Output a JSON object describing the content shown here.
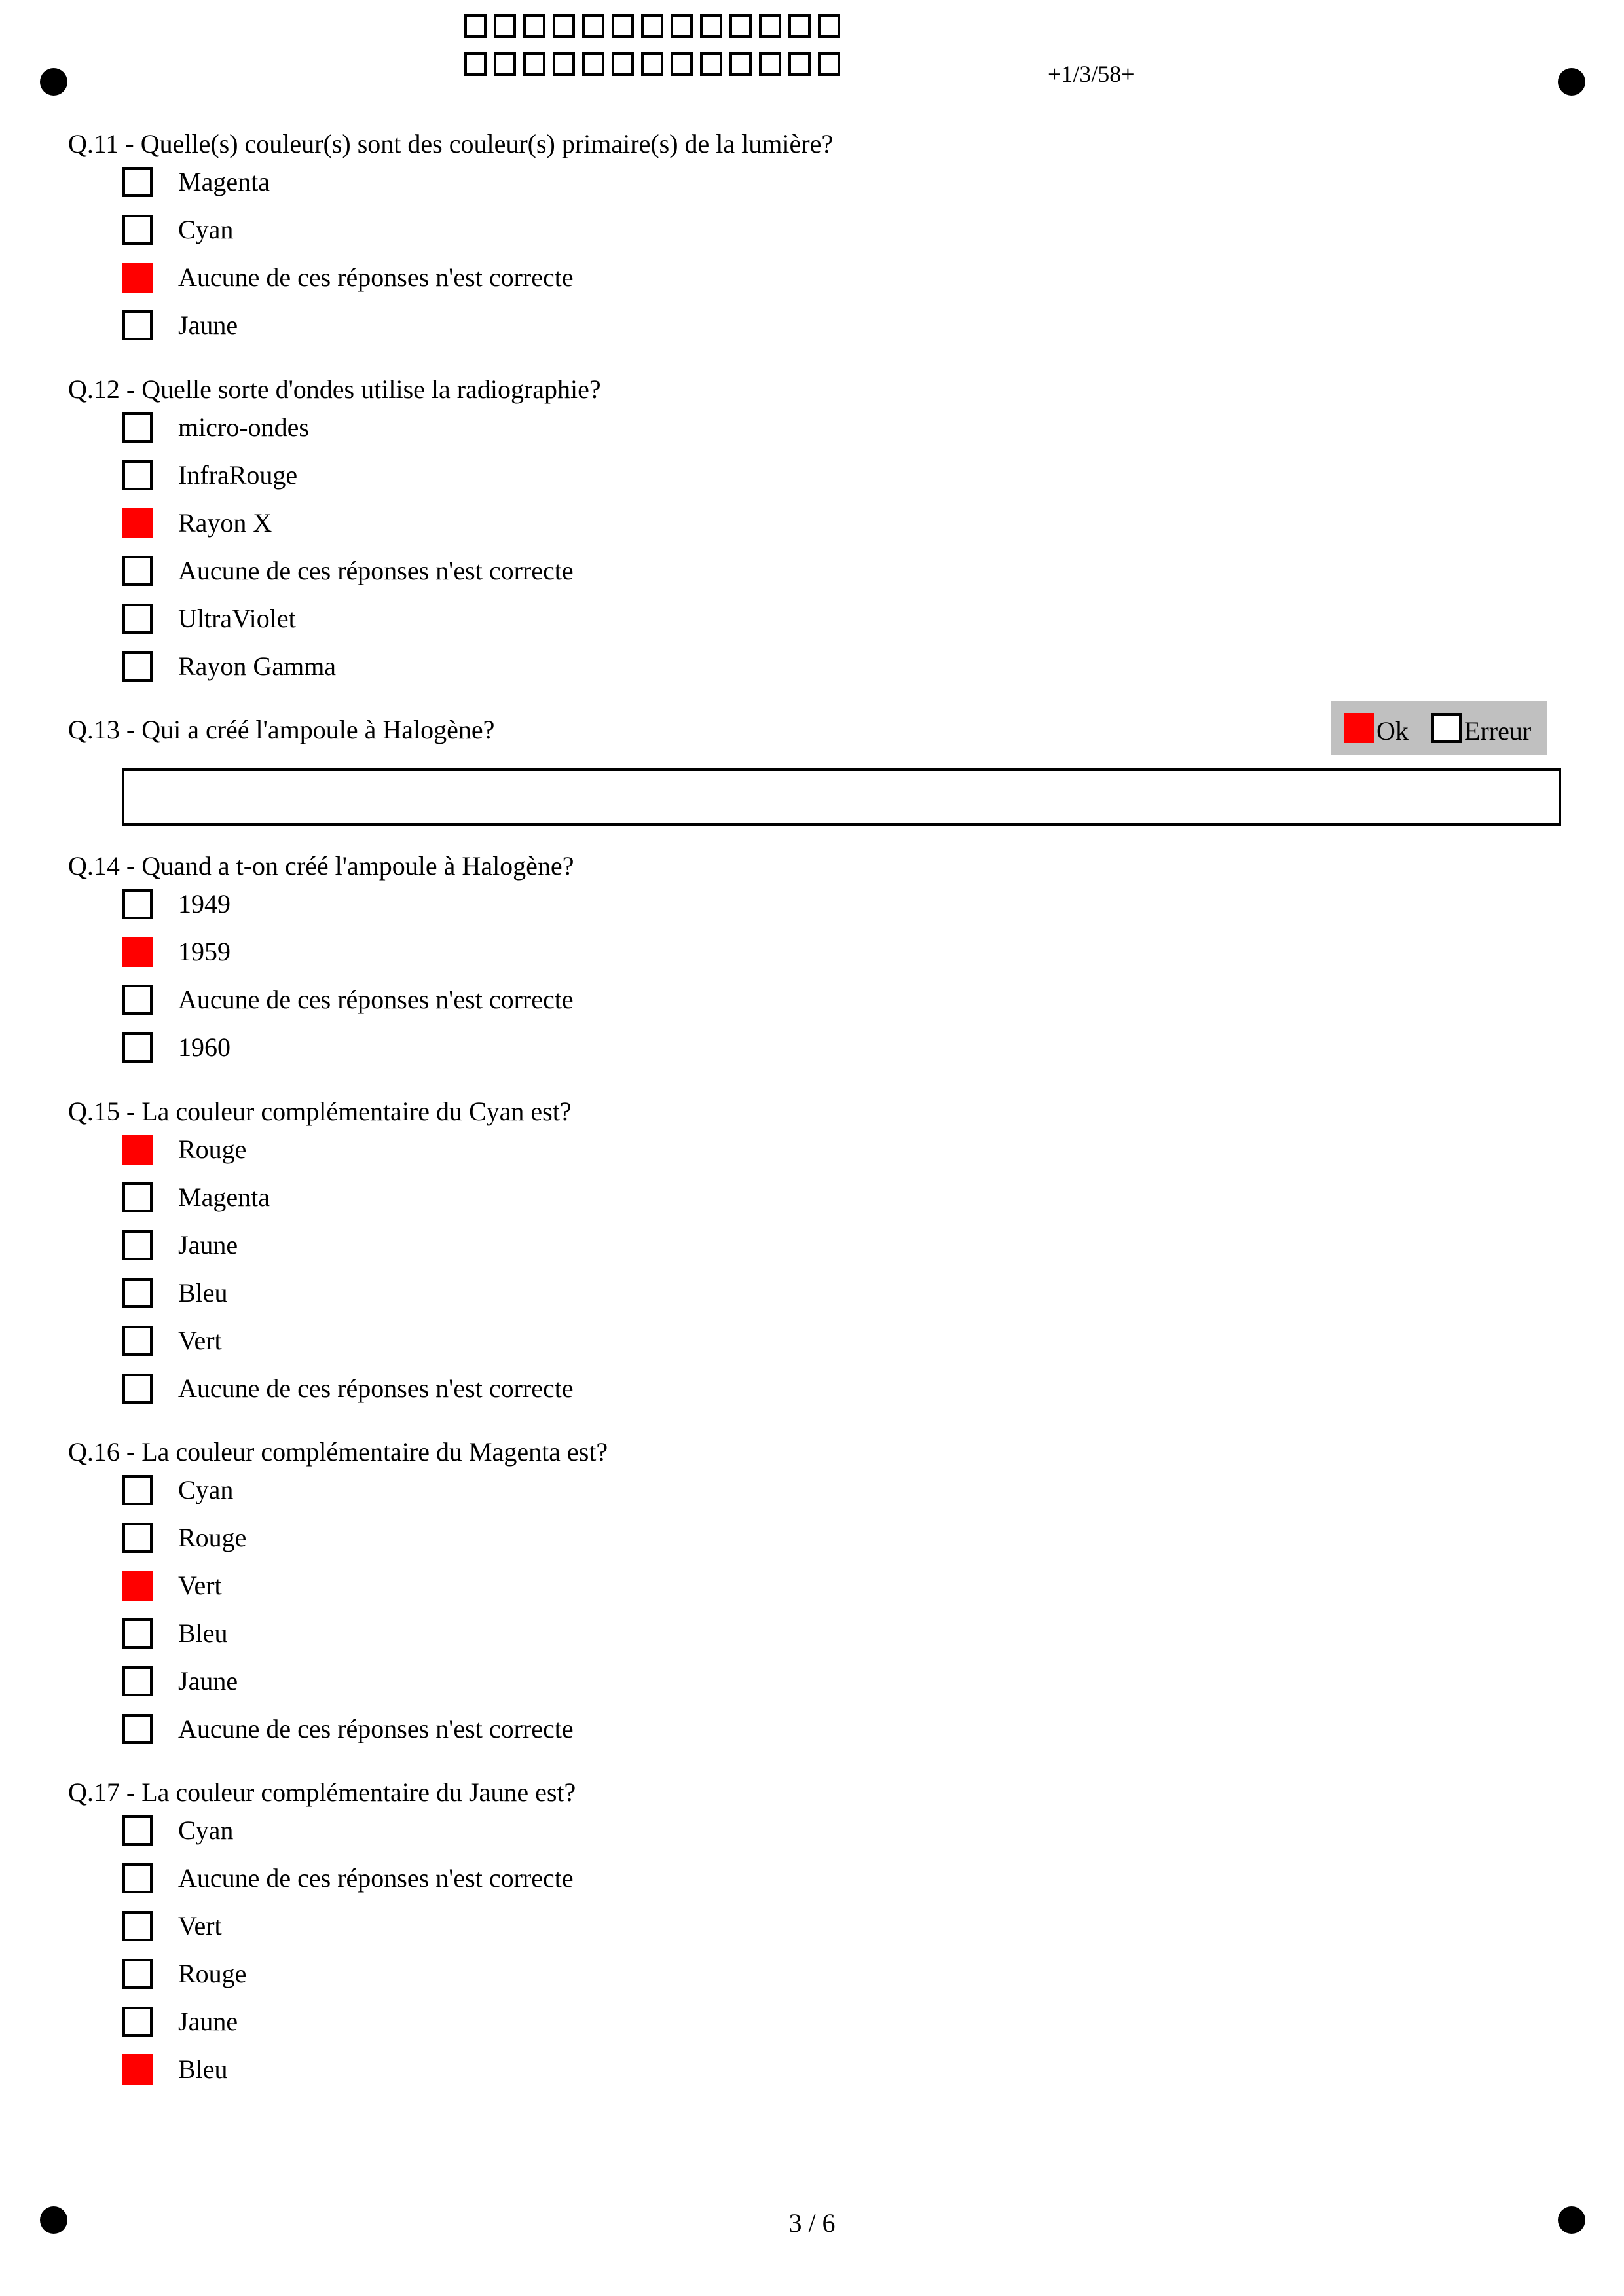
{
  "header": {
    "code": "+1/3/58+",
    "id_boxes_per_row": 13
  },
  "colors": {
    "checked": "#ff0000",
    "ok_panel": "#c0c0c0"
  },
  "questions": [
    {
      "title": "Q.11 - Quelle(s) couleur(s) sont des couleur(s) primaire(s) de la lumière?",
      "choices": [
        {
          "label": "Magenta",
          "checked": false
        },
        {
          "label": "Cyan",
          "checked": false
        },
        {
          "label": "Aucune de ces réponses n'est correcte",
          "checked": true
        },
        {
          "label": "Jaune",
          "checked": false
        }
      ]
    },
    {
      "title": "Q.12 - Quelle sorte d'ondes utilise la radiographie?",
      "choices": [
        {
          "label": "micro-ondes",
          "checked": false
        },
        {
          "label": "InfraRouge",
          "checked": false
        },
        {
          "label": "Rayon X",
          "checked": true
        },
        {
          "label": "Aucune de ces réponses n'est correcte",
          "checked": false
        },
        {
          "label": "UltraViolet",
          "checked": false
        },
        {
          "label": "Rayon Gamma",
          "checked": false
        }
      ]
    },
    {
      "title": "Q.13 - Qui a créé l'ampoule à Halogène?",
      "open": true,
      "ok_label": "Ok",
      "error_label": "Erreur",
      "ok_checked": true,
      "error_checked": false,
      "answer": ""
    },
    {
      "title": "Q.14 - Quand a t-on créé l'ampoule à Halogène?",
      "choices": [
        {
          "label": "1949",
          "checked": false
        },
        {
          "label": "1959",
          "checked": true
        },
        {
          "label": "Aucune de ces réponses n'est correcte",
          "checked": false
        },
        {
          "label": "1960",
          "checked": false
        }
      ]
    },
    {
      "title": "Q.15 - La couleur complémentaire du Cyan est?",
      "choices": [
        {
          "label": "Rouge",
          "checked": true
        },
        {
          "label": "Magenta",
          "checked": false
        },
        {
          "label": "Jaune",
          "checked": false
        },
        {
          "label": "Bleu",
          "checked": false
        },
        {
          "label": "Vert",
          "checked": false
        },
        {
          "label": "Aucune de ces réponses n'est correcte",
          "checked": false
        }
      ]
    },
    {
      "title": "Q.16 - La couleur complémentaire du Magenta est?",
      "choices": [
        {
          "label": "Cyan",
          "checked": false
        },
        {
          "label": "Rouge",
          "checked": false
        },
        {
          "label": "Vert",
          "checked": true
        },
        {
          "label": "Bleu",
          "checked": false
        },
        {
          "label": "Jaune",
          "checked": false
        },
        {
          "label": "Aucune de ces réponses n'est correcte",
          "checked": false
        }
      ]
    },
    {
      "title": "Q.17 - La couleur complémentaire du Jaune est?",
      "choices": [
        {
          "label": "Cyan",
          "checked": false
        },
        {
          "label": "Aucune de ces réponses n'est correcte",
          "checked": false
        },
        {
          "label": "Vert",
          "checked": false
        },
        {
          "label": "Rouge",
          "checked": false
        },
        {
          "label": "Jaune",
          "checked": false
        },
        {
          "label": "Bleu",
          "checked": true
        }
      ]
    }
  ],
  "footer": {
    "page": "3 / 6"
  }
}
